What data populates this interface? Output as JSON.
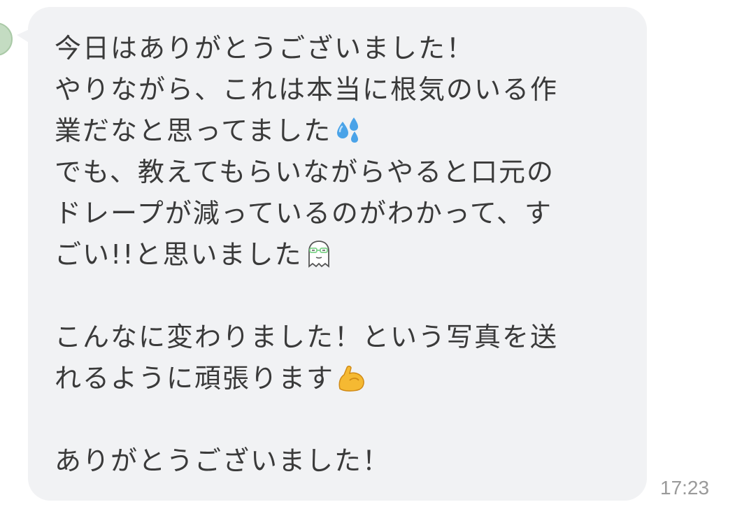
{
  "message": {
    "lines": [
      "今日はありがとうございました！",
      "やりながら、これは本当に根気のいる作",
      "業だなと思ってました",
      "でも、教えてもらいながらやると口元の",
      "ドレープが減っているのがわかって、す",
      "ごい!!と思いました",
      "",
      "こんなに変わりました！という写真を送",
      "れるように頑張ります",
      "",
      "ありがとうございました！"
    ],
    "emojis": {
      "line_3": "sweat-droplets-icon",
      "line_6": "ghost-with-glasses-icon",
      "line_9": "flexed-biceps-icon"
    },
    "timestamp": "17:23"
  },
  "colors": {
    "bubble_bg": "#f1f2f4",
    "text": "#3a3a3a",
    "timestamp": "#9a9a9a",
    "avatar": "#c4dcc2"
  }
}
